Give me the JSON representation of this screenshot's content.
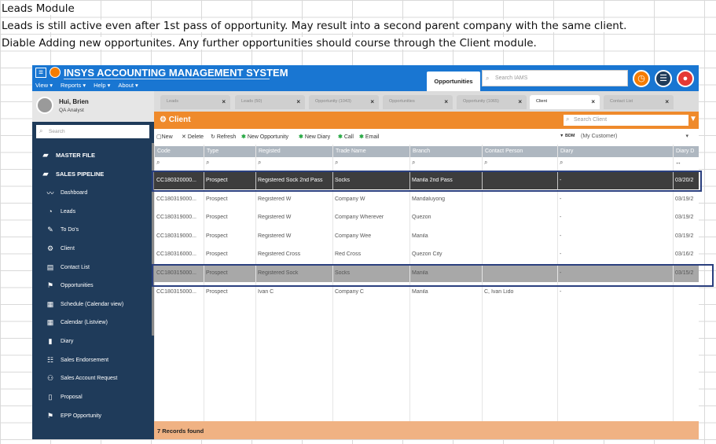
{
  "notes": [
    "Leads Module",
    "Leads is still active even after 1st pass of opportunity. May result into a second parent company with the same client.",
    "Diable Adding new opportunites. Any further opportunities should course through the Client module."
  ],
  "app": {
    "title": "INSYS ACCOUNTING MANAGEMENT SYSTEM",
    "menu": {
      "view": "View ▾",
      "reports": "Reports ▾",
      "help": "Help ▾",
      "about": "About ▾"
    },
    "top_tab": "Opportunities",
    "search_placeholder": "Search IAMS"
  },
  "user": {
    "name": "Hui, Brien",
    "role": "QA Analyst"
  },
  "sidebar": {
    "search_placeholder": "Search",
    "items": [
      {
        "label": "MASTER FILE",
        "icon": "folder-icon",
        "head": true
      },
      {
        "label": "SALES PIPELINE",
        "icon": "folder-open-icon",
        "head": true
      },
      {
        "label": "Dashboard",
        "icon": "trend-icon"
      },
      {
        "label": "Leads",
        "icon": "pie-icon"
      },
      {
        "label": "To Do's",
        "icon": "pencil-icon"
      },
      {
        "label": "Client",
        "icon": "client-icon"
      },
      {
        "label": "Contact List",
        "icon": "contact-card-icon"
      },
      {
        "label": "Opportunities",
        "icon": "people-add-icon"
      },
      {
        "label": "Schedule (Calendar view)",
        "icon": "calendar-icon"
      },
      {
        "label": "Calendar (Listview)",
        "icon": "calendar-list-icon"
      },
      {
        "label": "Diary",
        "icon": "book-icon"
      },
      {
        "label": "Sales Endorsement",
        "icon": "people-icon"
      },
      {
        "label": "Sales Account Request",
        "icon": "people-plus-icon"
      },
      {
        "label": "Proposal",
        "icon": "document-icon"
      },
      {
        "label": "EPP Opportunity",
        "icon": "people-add-icon"
      }
    ]
  },
  "tabs": [
    {
      "label": "Leads"
    },
    {
      "label": "Leads (50)"
    },
    {
      "label": "Opportunity (1043)"
    },
    {
      "label": "Opportunities"
    },
    {
      "label": "Opportunity (1065)"
    },
    {
      "label": "Client",
      "active": true
    },
    {
      "label": "Contact List"
    }
  ],
  "panel": {
    "title": "Client",
    "search_placeholder": "Search Client",
    "toolbar": {
      "new": "New",
      "delete": "Delete",
      "refresh": "Refresh",
      "new_opportunity": "New Opportunity",
      "new_diary": "New Diary",
      "call": "Call",
      "email": "Email"
    },
    "bdm_label": "BDM",
    "bdm_value": "(My Customer)"
  },
  "table": {
    "columns": [
      "Code",
      "Type",
      "Registed",
      "Trade Name",
      "Branch",
      "Contact Person",
      "Diary",
      "Diary D"
    ],
    "rows": [
      {
        "state": "sel",
        "cells": [
          "CC180320000...",
          "Prospect",
          "Registered Sock 2nd Pass",
          "Socks",
          "Manila 2nd Pass",
          "",
          "-",
          "03/20/2"
        ]
      },
      {
        "state": "",
        "cells": [
          "CC180319000...",
          "Prospect",
          "Registered W",
          "Company W",
          "Mandaluyong",
          "",
          "-",
          "03/19/2"
        ]
      },
      {
        "state": "",
        "cells": [
          "CC180319000...",
          "Prospect",
          "Registered W",
          "Company Wherever",
          "Quezon",
          "",
          "-",
          "03/19/2"
        ]
      },
      {
        "state": "",
        "cells": [
          "CC180319000...",
          "Prospect",
          "Registered W",
          "Company Wee",
          "Manila",
          "",
          "-",
          "03/19/2"
        ]
      },
      {
        "state": "",
        "cells": [
          "CC180316000...",
          "Prospect",
          "Registered Cross",
          "Red Cross",
          "Quezon City",
          "",
          "-",
          "03/16/2"
        ]
      },
      {
        "state": "hl",
        "cells": [
          "CC180315000...",
          "Prospect",
          "Registered Sock",
          "Socks",
          "Manila",
          "",
          "-",
          "03/15/2"
        ]
      },
      {
        "state": "",
        "cells": [
          "CC180315000...",
          "Prospect",
          "Ivan C",
          "Company C",
          "Manila",
          "C, Ivan Lido",
          "-",
          ""
        ]
      }
    ],
    "footer": "7 Records found"
  }
}
